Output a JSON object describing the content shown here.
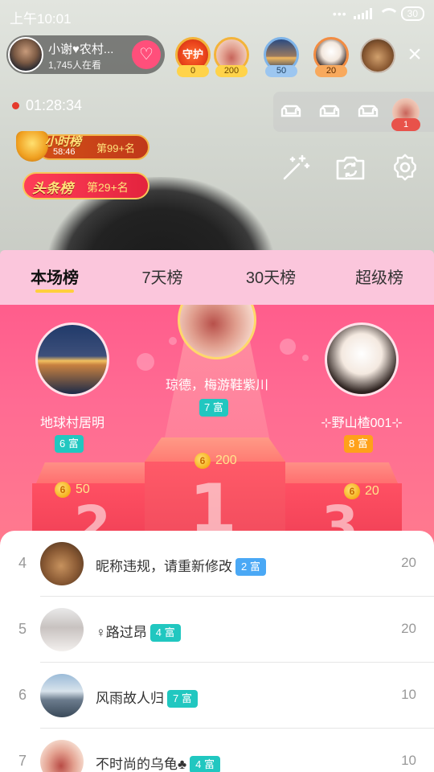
{
  "status_bar": {
    "time": "上午10:01",
    "signal_dots": "•••",
    "battery": "30"
  },
  "host": {
    "name": "小谢♥农村...",
    "viewers": "1,745人在看",
    "follow_icon": "heart-plus-icon"
  },
  "top_viewers": [
    {
      "label": "守护",
      "value": "0"
    },
    {
      "value": "200"
    },
    {
      "value": "50"
    },
    {
      "value": "20"
    }
  ],
  "close_icon": "×",
  "live_timer": "01:28:34",
  "seats": {
    "count": "1"
  },
  "hour_badge": {
    "title": "小时榜",
    "time": "58:46",
    "rank": "第99+名"
  },
  "head_badge": {
    "title": "头条榜",
    "rank": "第29+名"
  },
  "tabs": [
    "本场榜",
    "7天榜",
    "30天榜",
    "超级榜"
  ],
  "active_tab": "本场榜",
  "podium": {
    "first": {
      "name": "琼德，梅游鞋紫川",
      "rich": "7 富",
      "coins": "200",
      "rank_glyph": "1"
    },
    "second": {
      "name": "地球村居明",
      "rich": "6 富",
      "coins": "50",
      "rank_glyph": "2"
    },
    "third": {
      "name": "⊹野山楂001⊹",
      "rich": "8 富",
      "coins": "20",
      "rank_glyph": "3"
    }
  },
  "coin_symbol": "6",
  "ranking_list": [
    {
      "rank": "4",
      "name": "昵称违规，请重新修改",
      "rich": "2 富",
      "score": "20"
    },
    {
      "rank": "5",
      "name": "♀路过昂",
      "rich": "4 富",
      "score": "20"
    },
    {
      "rank": "6",
      "name": "风雨故人归",
      "rich": "7 富",
      "score": "10"
    },
    {
      "rank": "7",
      "name": "不时尚的乌龟♣",
      "rich": "4 富",
      "score": "10"
    }
  ],
  "colors": {
    "accent_pink": "#ff5d8c",
    "tab_bar": "#fbc6dc",
    "rich_teal": "#21c7c0",
    "rich_blue": "#4aa8f5",
    "rich_orange": "#ffa11a"
  }
}
